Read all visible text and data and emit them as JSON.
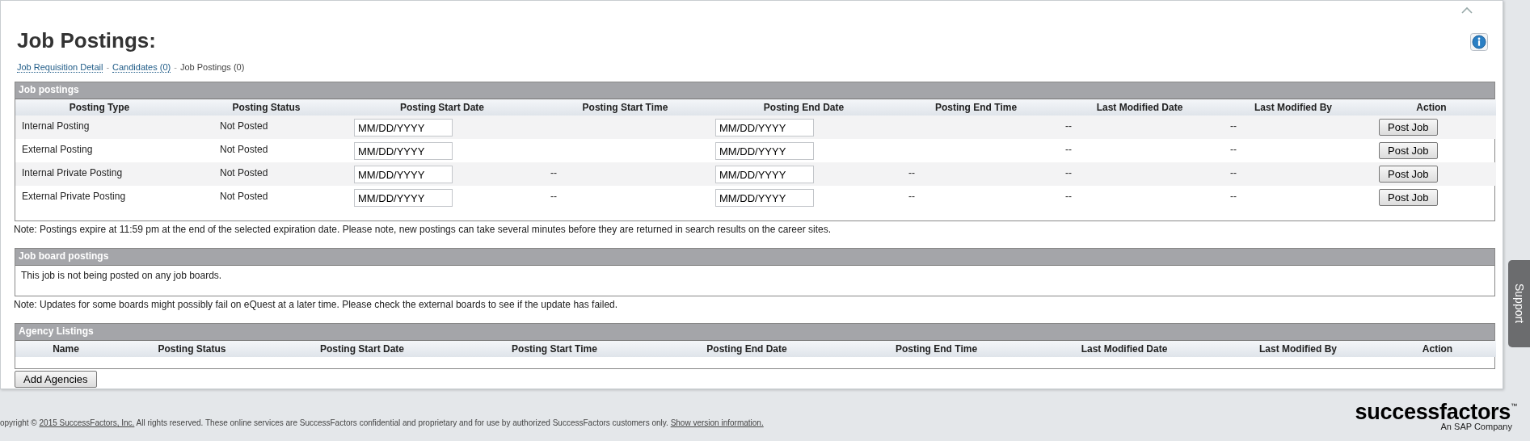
{
  "page": {
    "title": "Job Postings:"
  },
  "breadcrumb": {
    "separator": "-",
    "items": [
      {
        "label": "Job Requisition Detail",
        "kind": "link"
      },
      {
        "label": "Candidates (0)",
        "kind": "link"
      },
      {
        "label": "Job Postings (0)",
        "kind": "current"
      }
    ]
  },
  "job_postings": {
    "title": "Job postings",
    "columns": [
      "Posting Type",
      "Posting Status",
      "Posting Start Date",
      "Posting Start Time",
      "Posting End Date",
      "Posting End Time",
      "Last Modified Date",
      "Last Modified By",
      "Action"
    ],
    "rows": [
      {
        "posting_type": "Internal Posting",
        "posting_status": "Not Posted",
        "start_date": "MM/DD/YYYY",
        "end_date": "MM/DD/YYYY",
        "last_modified_date": "--",
        "last_modified_by": "--",
        "action": "Post Job"
      },
      {
        "posting_type": "External Posting",
        "posting_status": "Not Posted",
        "start_date": "MM/DD/YYYY",
        "end_date": "MM/DD/YYYY",
        "last_modified_date": "--",
        "last_modified_by": "--",
        "action": "Post Job"
      },
      {
        "posting_type": "Internal Private Posting",
        "posting_status": "Not Posted",
        "start_date": "MM/DD/YYYY",
        "start_time": "--",
        "end_date": "MM/DD/YYYY",
        "end_time": "--",
        "last_modified_date": "--",
        "last_modified_by": "--",
        "action": "Post Job"
      },
      {
        "posting_type": "External Private Posting",
        "posting_status": "Not Posted",
        "start_date": "MM/DD/YYYY",
        "start_time": "--",
        "end_date": "MM/DD/YYYY",
        "end_time": "--",
        "last_modified_date": "--",
        "last_modified_by": "--",
        "action": "Post Job"
      }
    ],
    "note": "Note: Postings expire at 11:59 pm at the end of the selected expiration date. Please note, new postings can take several minutes before they are returned in search results on the career sites."
  },
  "job_board_postings": {
    "title": "Job board postings",
    "message": "This job is not being posted on any job boards.",
    "note": "Note: Updates for some boards might possibly fail on eQuest at a later time. Please check the external boards to see if the update has failed."
  },
  "agency_listings": {
    "title": "Agency Listings",
    "columns": [
      "Name",
      "Posting Status",
      "Posting Start Date",
      "Posting Start Time",
      "Posting End Date",
      "Posting End Time",
      "Last Modified Date",
      "Last Modified By",
      "Action"
    ],
    "button": "Add Agencies"
  },
  "support_tab": "Support",
  "footer": {
    "parts": [
      {
        "text": "opyright © ",
        "kind": "text"
      },
      {
        "text": "2015 SuccessFactors, Inc.",
        "kind": "link"
      },
      {
        "text": " All rights reserved. These online services are SuccessFactors confidential and proprietary and for use by authorized SuccessFactors customers only. ",
        "kind": "text"
      },
      {
        "text": "Show version information.",
        "kind": "link"
      }
    ]
  },
  "logo": {
    "name": "successfactors",
    "trademark": "™",
    "tagline": "An SAP Company"
  }
}
